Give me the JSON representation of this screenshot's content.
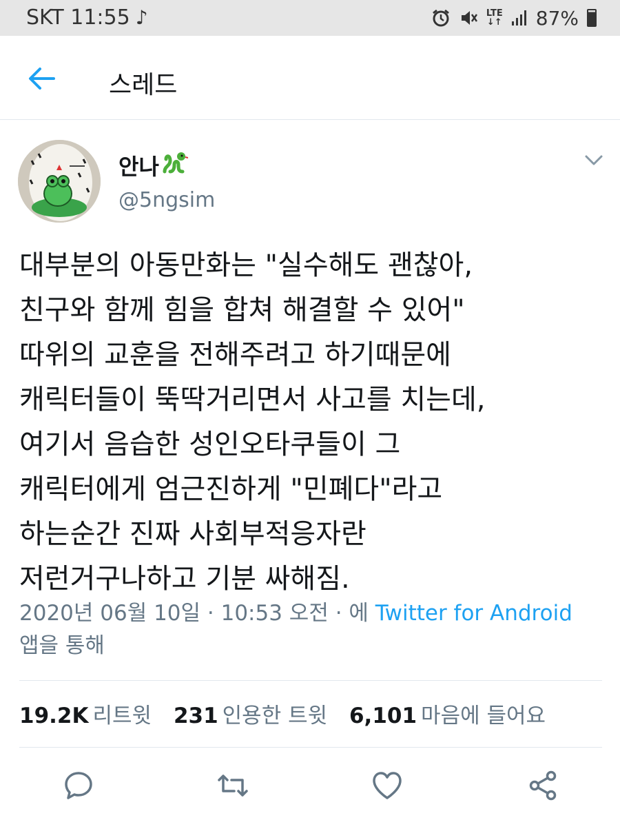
{
  "status_bar": {
    "carrier_time": "SKT 11:55",
    "music_note": "♪",
    "network_type": "LTE",
    "battery_percent": "87%"
  },
  "header": {
    "title": "스레드"
  },
  "tweet": {
    "display_name": "안나",
    "handle": "@5ngsim",
    "text_lines": [
      "대부분의 아동만화는 \"실수해도 괜찮아,",
      "친구와 함께 힘을 합쳐 해결할 수 있어\"",
      "따위의 교훈을 전해주려고 하기때문에",
      "캐릭터들이 뚝딱거리면서 사고를 치는데,",
      "여기서 음습한 성인오타쿠들이 그",
      "캐릭터에게 엄근진하게 \"민폐다\"라고",
      "하는순간 진짜 사회부적응자란",
      "저런거구나하고 기분 싸해짐."
    ],
    "timestamp": "2020년 06월 10일 · 10:53 오전 · 에",
    "source_app": "Twitter for Android",
    "source_suffix": "앱을 통해",
    "retweets_count": "19.2K",
    "retweets_label": "리트윗",
    "quotes_count": "231",
    "quotes_label": "인용한 트윗",
    "likes_count": "6,101",
    "likes_label": "마음에 들어요"
  },
  "icons": {
    "back": "back-arrow-icon",
    "caret": "chevron-down-icon",
    "reply": "reply-icon",
    "retweet": "retweet-icon",
    "like": "heart-icon",
    "share": "share-icon"
  },
  "colors": {
    "accent": "#1da1f2",
    "secondary_text": "#657786",
    "primary_text": "#14171a",
    "divider": "#e1e8ed",
    "status_bar_bg": "#e6e6e6"
  }
}
